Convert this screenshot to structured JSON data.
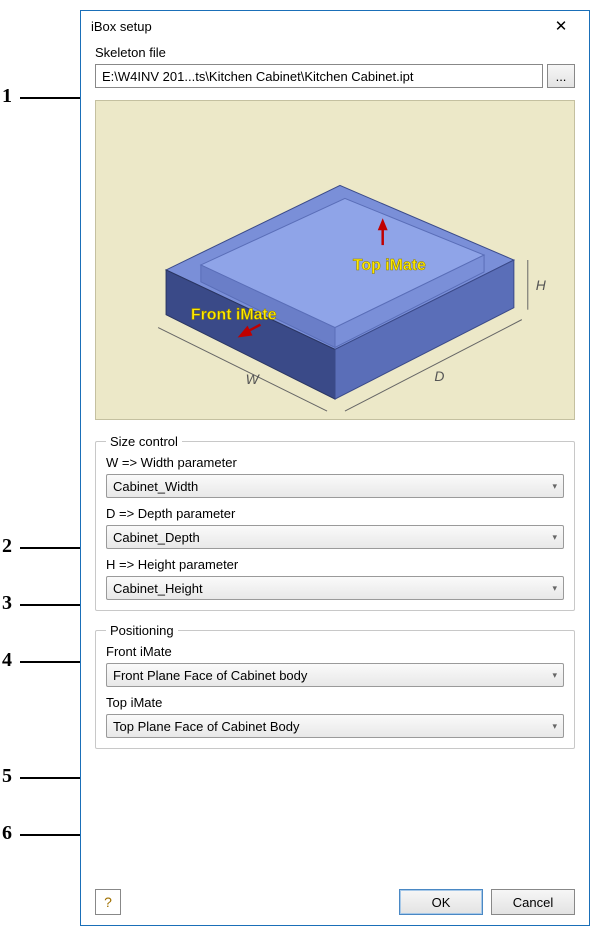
{
  "dialog": {
    "title": "iBox setup"
  },
  "skeleton": {
    "label": "Skeleton file",
    "path": "E:\\W4INV 201...ts\\Kitchen Cabinet\\Kitchen Cabinet.ipt",
    "browse": "..."
  },
  "preview": {
    "top_imate": "Top iMate",
    "front_imate": "Front iMate",
    "dim_w": "W",
    "dim_d": "D",
    "dim_h": "H"
  },
  "size_control": {
    "legend": "Size control",
    "width": {
      "label": "W => Width parameter",
      "value": "Cabinet_Width"
    },
    "depth": {
      "label": "D => Depth parameter",
      "value": "Cabinet_Depth"
    },
    "height": {
      "label": "H => Height parameter",
      "value": "Cabinet_Height"
    }
  },
  "positioning": {
    "legend": "Positioning",
    "front": {
      "label": "Front iMate",
      "value": "Front Plane Face of Cabinet body"
    },
    "top": {
      "label": "Top iMate",
      "value": "Top Plane Face of Cabinet Body"
    }
  },
  "buttons": {
    "ok": "OK",
    "cancel": "Cancel"
  },
  "annotations": {
    "n1": "1",
    "n2": "2",
    "n3": "3",
    "n4": "4",
    "n5": "5",
    "n6": "6"
  }
}
